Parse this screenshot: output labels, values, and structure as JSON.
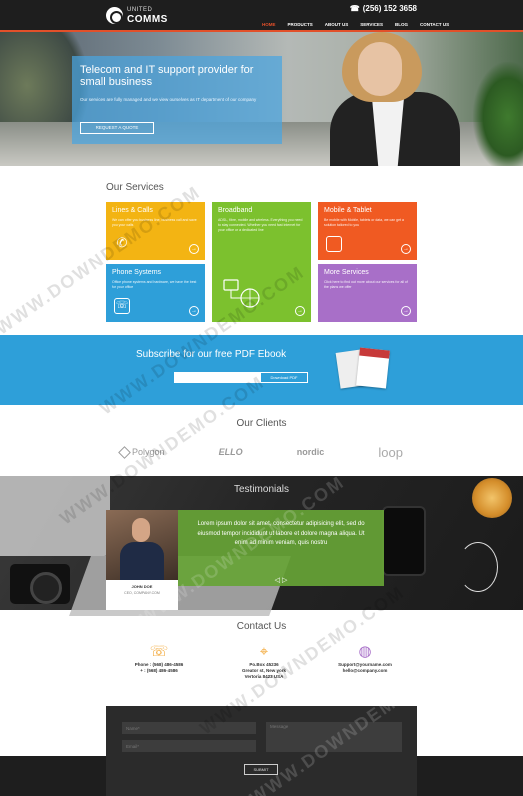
{
  "header": {
    "logo_small": "UNITED",
    "logo_big": "COMMS",
    "phone": "(256) 152 3658",
    "nav": [
      "HOME",
      "PRODUCTS",
      "ABOUT US",
      "SERVICES",
      "BLOG",
      "CONTACT US"
    ],
    "active_nav": "HOME"
  },
  "hero": {
    "title": "Telecom and IT support provider for small business",
    "text": "Our services are fully managed and we view ourselves as IT department of our company",
    "button": "REQUEST A QUOTE"
  },
  "services": {
    "title": "Our Services",
    "cards": [
      {
        "title": "Lines & Calls",
        "text": "We can offer you business line, business call and save you your calls",
        "color": "#f3b413",
        "icon": "phone-icon"
      },
      {
        "title": "Broadband",
        "text": "ADSL, fibre, mobile and wireless. Everything you need to stay connected. Whether you need fast internet for your office or a dedicated line",
        "color": "#7cc12e",
        "icon": "router-icon"
      },
      {
        "title": "Mobile & Tablet",
        "text": "Be mobile with Mobile, tablets or data, we can get a solution tailored to you",
        "color": "#f05a22",
        "icon": "tablet-icon"
      },
      {
        "title": "Phone Systems",
        "text": "Office phone systems and hardware, we have the best for your office",
        "color": "#2e9fd9",
        "icon": "phone-system-icon"
      },
      {
        "title": "",
        "text": "",
        "color": "#7cc12e",
        "icon": "network-icon"
      },
      {
        "title": "More Services",
        "text": "Click here to find out more about our services for all of the plans we offer",
        "color": "#a86fc8",
        "icon": "more-icon"
      }
    ]
  },
  "subscribe": {
    "title": "Subscribe for our free PDF Ebook",
    "input_placeholder": "",
    "button": "Download PDF"
  },
  "clients": {
    "title": "Our Clients",
    "logos": [
      "Polygon",
      "ELLO",
      "nordic",
      "loop"
    ]
  },
  "testimonials": {
    "title": "Testimonials",
    "name": "JOHN DOE",
    "company": "CEO, COMPANY.COM",
    "quote": "Lorem ipsum dolor sit amet, consectetur adipisicing elit, sed do eiusmod tempor incididunt ut labore et dolore magna aliqua. Ut enim ad minim veniam, quis nostru",
    "nav": "◁ ▷"
  },
  "contact": {
    "title": "Contact Us",
    "columns": [
      {
        "icon": "phone-icon",
        "lines": [
          "Phone : (568) 486-4586",
          "+ : (568) 486-4586"
        ]
      },
      {
        "icon": "map-pin-icon",
        "lines": [
          "Po.Box 45236",
          "Greator st, New york",
          "Vertoria 8423 USA"
        ]
      },
      {
        "icon": "globe-icon",
        "lines": [
          "Support@yourname.com",
          "hello@company.com"
        ]
      }
    ]
  },
  "form": {
    "name_placeholder": "Name*",
    "email_placeholder": "Email*",
    "message_placeholder": "Message",
    "submit": "SUBMIT"
  },
  "watermark": "WWW.DOWNDEMO.COM"
}
